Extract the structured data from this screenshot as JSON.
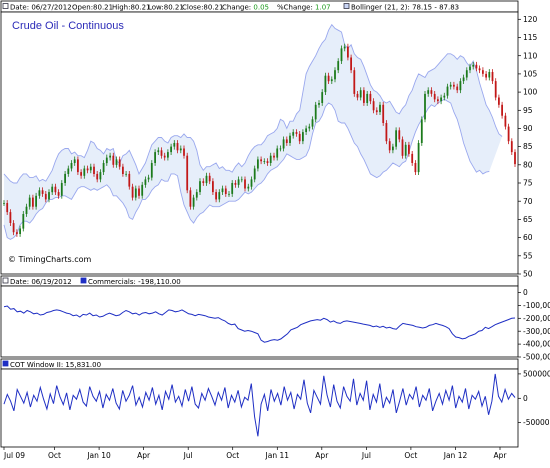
{
  "chart_data": [
    {
      "type": "candlestick",
      "title": "Crude Oil - Continuous",
      "header": {
        "date": "Date: 06/27/2012",
        "open": "Open:80.21",
        "high": "High:80.21",
        "low": "Low:80.21",
        "close": "Close:80.21",
        "change_label": "Change:",
        "change": "0.05",
        "pct_label": "%Change:",
        "pct": "1.07",
        "indicator": "Bollinger (21, 2): 78.15 - 87.83"
      },
      "watermark": "© TimingCharts.com",
      "ylim": [
        50,
        122
      ],
      "yticks": [
        "50",
        "55",
        "60",
        "65",
        "70",
        "75",
        "80",
        "85",
        "90",
        "95",
        "100",
        "105",
        "110",
        "115",
        "120"
      ],
      "close_series": [
        69.5,
        67.0,
        64.0,
        61.5,
        61.0,
        62.5,
        66.5,
        68.5,
        71.0,
        68.5,
        71.5,
        73.0,
        72.0,
        70.5,
        72.5,
        74.0,
        72.5,
        71.5,
        75.0,
        77.5,
        79.0,
        80.5,
        81.5,
        78.0,
        77.0,
        79.0,
        78.5,
        79.5,
        77.5,
        76.0,
        78.0,
        80.5,
        82.0,
        82.5,
        80.0,
        81.5,
        79.5,
        77.5,
        77.5,
        74.0,
        71.0,
        73.5,
        71.5,
        74.5,
        76.0,
        76.5,
        80.5,
        83.5,
        84.0,
        82.5,
        82.0,
        83.5,
        85.0,
        86.0,
        84.0,
        84.5,
        82.5,
        73.0,
        68.5,
        71.0,
        72.5,
        75.5,
        75.0,
        77.0,
        75.5,
        72.5,
        70.5,
        72.5,
        73.5,
        72.0,
        72.0,
        75.0,
        74.5,
        76.0,
        76.0,
        73.5,
        74.0,
        76.0,
        79.0,
        81.5,
        81.0,
        81.0,
        80.5,
        82.5,
        82.0,
        84.5,
        84.5,
        87.0,
        86.0,
        88.0,
        89.0,
        88.5,
        86.5,
        89.0,
        90.0,
        90.5,
        92.5,
        96.5,
        97.0,
        100.0,
        104.5,
        103.0,
        103.5,
        106.0,
        108.5,
        112.0,
        112.5,
        109.5,
        106.0,
        99.5,
        98.5,
        100.5,
        97.0,
        99.5,
        97.5,
        95.0,
        94.5,
        96.5,
        91.5,
        86.5,
        84.0,
        85.0,
        89.5,
        87.0,
        82.5,
        85.5,
        83.0,
        80.5,
        78.0,
        86.0,
        92.5,
        99.5,
        100.5,
        99.5,
        98.0,
        97.5,
        98.5,
        99.0,
        101.5,
        102.0,
        101.5,
        100.5,
        103.0,
        104.0,
        106.0,
        107.0,
        107.5,
        106.5,
        106.0,
        105.0,
        104.0,
        105.5,
        103.0,
        98.5,
        96.5,
        93.5,
        90.5,
        86.5,
        83.5,
        80.2
      ],
      "upper_series": [
        77.5,
        76.5,
        75.5,
        75.0,
        75.0,
        76.5,
        77.5,
        77.5,
        76.5,
        76.5,
        77.0,
        75.5,
        76.0,
        75.5,
        77.0,
        78.5,
        81.0,
        83.0,
        84.0,
        84.5,
        84.5,
        83.0,
        83.5,
        82.5,
        82.5,
        82.0,
        84.0,
        86.5,
        86.0,
        84.5,
        84.0,
        83.0,
        84.5,
        84.0,
        84.5,
        81.0,
        80.5,
        82.5,
        83.0,
        84.0,
        82.0,
        80.0,
        77.5,
        79.0,
        80.5,
        83.0,
        85.5,
        86.5,
        87.5,
        87.5,
        86.5,
        86.0,
        87.5,
        88.0,
        88.0,
        87.5,
        88.5,
        87.5,
        87.5,
        86.5,
        84.0,
        80.0,
        78.5,
        79.5,
        79.5,
        80.0,
        80.5,
        79.0,
        79.5,
        78.5,
        78.5,
        78.0,
        79.5,
        80.5,
        79.5,
        80.5,
        82.5,
        84.0,
        85.0,
        85.5,
        85.5,
        86.5,
        88.0,
        88.5,
        89.0,
        90.0,
        92.5,
        92.0,
        90.0,
        92.0,
        92.0,
        94.0,
        95.0,
        100.0,
        105.0,
        107.0,
        108.5,
        110.0,
        112.0,
        113.5,
        114.5,
        117.0,
        118.5,
        117.5,
        117.0,
        116.5,
        113.0,
        112.0,
        113.0,
        110.5,
        109.5,
        109.0,
        107.0,
        104.5,
        102.0,
        100.5,
        100.0,
        99.0,
        97.5,
        97.0,
        97.5,
        96.0,
        94.5,
        94.0,
        95.5,
        96.5,
        99.0,
        100.5,
        103.0,
        105.0,
        104.5,
        104.0,
        105.5,
        106.0,
        106.5,
        107.5,
        108.5,
        109.5,
        110.5,
        110.5,
        110.0,
        109.0,
        110.0,
        109.5,
        108.0,
        107.0,
        108.5,
        106.0,
        102.5,
        99.5,
        96.5,
        95.0,
        93.0,
        90.5,
        88.5,
        87.8
      ],
      "lower_series": [
        63.5,
        60.0,
        59.5,
        60.0,
        61.0,
        63.5,
        64.5,
        64.5,
        64.0,
        65.0,
        66.5,
        67.5,
        68.0,
        69.5,
        70.5,
        70.5,
        71.0,
        71.0,
        71.5,
        71.5,
        71.0,
        70.5,
        72.0,
        73.5,
        74.0,
        74.0,
        73.5,
        73.0,
        73.5,
        73.0,
        73.5,
        74.0,
        74.5,
        73.5,
        71.5,
        71.5,
        70.5,
        69.5,
        68.0,
        65.5,
        65.0,
        67.0,
        68.5,
        70.5,
        70.5,
        71.5,
        73.0,
        74.0,
        74.5,
        76.0,
        75.5,
        75.5,
        77.5,
        77.5,
        77.0,
        72.5,
        69.0,
        67.0,
        65.0,
        64.0,
        65.5,
        66.5,
        67.0,
        68.0,
        69.0,
        68.5,
        68.5,
        68.5,
        69.0,
        69.5,
        70.0,
        70.0,
        70.0,
        70.5,
        71.5,
        72.5,
        72.0,
        72.5,
        73.5,
        74.5,
        75.0,
        76.0,
        77.5,
        78.5,
        79.0,
        79.5,
        80.5,
        81.5,
        83.0,
        82.5,
        82.0,
        81.5,
        81.5,
        82.0,
        82.5,
        84.5,
        88.5,
        91.5,
        92.0,
        93.5,
        96.0,
        97.0,
        96.5,
        95.0,
        92.0,
        91.5,
        91.5,
        90.0,
        88.0,
        86.0,
        85.0,
        83.0,
        81.5,
        79.5,
        77.5,
        77.0,
        76.5,
        77.0,
        78.0,
        78.5,
        79.5,
        80.5,
        80.0,
        79.5,
        80.5,
        81.0,
        83.5,
        86.5,
        89.0,
        91.0,
        92.5,
        94.0,
        95.5,
        96.5,
        96.0,
        97.0,
        97.5,
        98.0,
        97.5,
        97.0,
        94.5,
        92.5,
        89.5,
        86.0,
        83.5,
        81.0,
        79.5,
        78.0,
        78.5,
        77.5,
        78.0,
        78.2
      ]
    },
    {
      "type": "line",
      "header": {
        "date": "Date: 06/19/2012",
        "series_name": "Commercials: -198,110.00"
      },
      "ylim": [
        -500000,
        50000
      ],
      "yticks": [
        "0",
        "-100,000",
        "-200,000",
        "-300,000",
        "-400,000",
        "-500,000"
      ],
      "series": [
        {
          "name": "Commercials",
          "values": [
            -110000,
            -105000,
            -130000,
            -125000,
            -150000,
            -145000,
            -160000,
            -140000,
            -150000,
            -165000,
            -160000,
            -175000,
            -170000,
            -155000,
            -150000,
            -140000,
            -135000,
            -140000,
            -150000,
            -160000,
            -165000,
            -180000,
            -175000,
            -190000,
            -170000,
            -175000,
            -160000,
            -180000,
            -175000,
            -190000,
            -185000,
            -170000,
            -160000,
            -170000,
            -180000,
            -175000,
            -155000,
            -140000,
            -150000,
            -165000,
            -160000,
            -175000,
            -160000,
            -155000,
            -165000,
            -160000,
            -150000,
            -165000,
            -175000,
            -155000,
            -135000,
            -140000,
            -150000,
            -145000,
            -135000,
            -150000,
            -165000,
            -170000,
            -180000,
            -170000,
            -175000,
            -180000,
            -190000,
            -195000,
            -200000,
            -195000,
            -210000,
            -220000,
            -240000,
            -250000,
            -245000,
            -280000,
            -290000,
            -300000,
            -295000,
            -300000,
            -310000,
            -320000,
            -370000,
            -385000,
            -380000,
            -370000,
            -365000,
            -370000,
            -360000,
            -340000,
            -320000,
            -290000,
            -280000,
            -270000,
            -250000,
            -240000,
            -230000,
            -220000,
            -215000,
            -210000,
            -215000,
            -200000,
            -210000,
            -230000,
            -220000,
            -235000,
            -240000,
            -225000,
            -220000,
            -225000,
            -230000,
            -235000,
            -240000,
            -245000,
            -250000,
            -255000,
            -265000,
            -260000,
            -270000,
            -262000,
            -275000,
            -270000,
            -280000,
            -285000,
            -260000,
            -240000,
            -245000,
            -250000,
            -255000,
            -265000,
            -270000,
            -275000,
            -270000,
            -255000,
            -250000,
            -240000,
            -248000,
            -255000,
            -265000,
            -280000,
            -320000,
            -345000,
            -350000,
            -360000,
            -355000,
            -340000,
            -330000,
            -320000,
            -300000,
            -295000,
            -270000,
            -280000,
            -265000,
            -250000,
            -240000,
            -230000,
            -220000,
            -210000,
            -200000,
            -198110
          ]
        }
      ]
    },
    {
      "type": "line",
      "header": {
        "series_name": "COT Window II: 15,831.00"
      },
      "ylim": [
        -1000000,
        600000
      ],
      "yticks": [
        "500000",
        "0",
        "-500000"
      ],
      "series": [
        {
          "name": "COT Window II",
          "values": [
            -120000,
            80000,
            -60000,
            -260000,
            180000,
            40000,
            -100000,
            120000,
            -180000,
            60000,
            -60000,
            220000,
            -20000,
            -220000,
            90000,
            -110000,
            260000,
            30000,
            -130000,
            110000,
            -240000,
            60000,
            -20000,
            180000,
            -80000,
            -160000,
            240000,
            40000,
            -60000,
            140000,
            -200000,
            80000,
            -40000,
            200000,
            -100000,
            -220000,
            160000,
            -60000,
            60000,
            260000,
            -140000,
            20000,
            -180000,
            120000,
            -40000,
            220000,
            -120000,
            60000,
            -240000,
            140000,
            -20000,
            280000,
            -80000,
            40000,
            -160000,
            180000,
            -60000,
            240000,
            -120000,
            -200000,
            100000,
            -40000,
            200000,
            40000,
            -140000,
            120000,
            -40000,
            220000,
            -200000,
            60000,
            -80000,
            160000,
            -180000,
            20000,
            -40000,
            300000,
            -380000,
            -780000,
            -120000,
            80000,
            -260000,
            180000,
            -60000,
            100000,
            -140000,
            240000,
            -40000,
            120000,
            -220000,
            80000,
            -20000,
            380000,
            -100000,
            -300000,
            160000,
            20000,
            -120000,
            460000,
            60000,
            -180000,
            280000,
            -60000,
            -200000,
            240000,
            40000,
            -60000,
            400000,
            -140000,
            100000,
            -40000,
            360000,
            -240000,
            80000,
            -80000,
            300000,
            -200000,
            20000,
            -100000,
            180000,
            -300000,
            -60000,
            200000,
            -140000,
            80000,
            -20000,
            240000,
            -180000,
            60000,
            -40000,
            200000,
            -260000,
            -60000,
            100000,
            -120000,
            160000,
            -40000,
            260000,
            -200000,
            40000,
            -80000,
            200000,
            -220000,
            60000,
            -20000,
            140000,
            -160000,
            40000,
            -340000,
            -60000,
            500000,
            40000,
            -80000,
            180000,
            -20000,
            100000,
            15831
          ]
        }
      ]
    }
  ],
  "x_axis": {
    "ticks": [
      "Jul 09",
      "Oct",
      "Jan 10",
      "Apr",
      "Jul",
      "Oct",
      "Jan 11",
      "Apr",
      "Jul",
      "Oct",
      "Jan 12",
      "Apr"
    ]
  },
  "colors": {
    "panel_border": "#000000",
    "band_fill": "#e6eefa",
    "band_line": "#9aa8ee",
    "candle_up": "#1c7a1c",
    "candle_down": "#c21818",
    "line": "#1f2fc4",
    "title": "#2b2bb8",
    "change_value": "#1a9a1a",
    "grid": "#c8c8c8"
  }
}
